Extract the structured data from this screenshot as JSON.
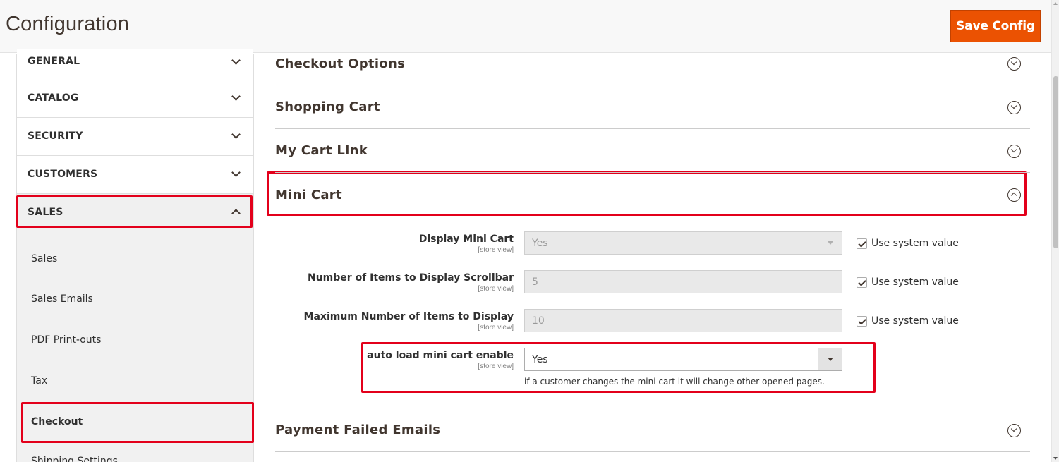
{
  "header": {
    "title": "Configuration",
    "save_label": "Save Config"
  },
  "sidebar": {
    "tabs": [
      {
        "label": "GENERAL",
        "state": "collapsed"
      },
      {
        "label": "CATALOG",
        "state": "collapsed"
      },
      {
        "label": "SECURITY",
        "state": "collapsed"
      },
      {
        "label": "CUSTOMERS",
        "state": "collapsed"
      },
      {
        "label": "SALES",
        "state": "expanded"
      }
    ],
    "sales_items": [
      {
        "label": "Sales"
      },
      {
        "label": "Sales Emails"
      },
      {
        "label": "PDF Print-outs"
      },
      {
        "label": "Tax"
      },
      {
        "label": "Checkout",
        "active": true
      },
      {
        "label": "Shipping Settings"
      }
    ]
  },
  "main": {
    "sections": [
      {
        "title": "Checkout Options",
        "state": "collapsed"
      },
      {
        "title": "Shopping Cart",
        "state": "collapsed"
      },
      {
        "title": "My Cart Link",
        "state": "collapsed"
      },
      {
        "title": "Mini Cart",
        "state": "expanded"
      },
      {
        "title": "Payment Failed Emails",
        "state": "collapsed"
      }
    ],
    "mini_cart_fields": [
      {
        "label": "Display Mini Cart",
        "scope": "[store view]",
        "value": "Yes",
        "type": "select",
        "use_system_value": true,
        "system_value_label": "Use system value"
      },
      {
        "label": "Number of Items to Display Scrollbar",
        "scope": "[store view]",
        "value": "5",
        "type": "text",
        "use_system_value": true,
        "system_value_label": "Use system value"
      },
      {
        "label": "Maximum Number of Items to Display",
        "scope": "[store view]",
        "value": "10",
        "type": "text",
        "use_system_value": true,
        "system_value_label": "Use system value"
      },
      {
        "label": "auto load mini cart enable",
        "scope": "[store view]",
        "value": "Yes",
        "type": "select",
        "note": "if a customer changes the mini cart it will change other opened pages."
      }
    ]
  },
  "colors": {
    "accent": "#eb5202",
    "highlight": "#e3001b",
    "text": "#303030",
    "title": "#41362f"
  }
}
